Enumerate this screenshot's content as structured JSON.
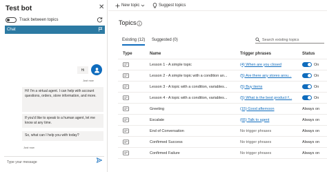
{
  "bot_panel": {
    "title": "Test bot",
    "close_glyph": "✕",
    "track_label": "Track between topics",
    "chat_header": "Chat",
    "user_message": "Hi",
    "user_time": "Just now",
    "bot_messages": [
      "Hi! I'm a virtual agent. I can help with account questions, orders, store information, and more.",
      "If you'd like to speak to a human agent, let me know at any time.",
      "So, what can I help you with today?"
    ],
    "bot_time": "Just now",
    "input_placeholder": "Type your message",
    "icons": [
      "refresh-icon",
      "flag-icon",
      "user-avatar-icon",
      "send-icon"
    ]
  },
  "toolbar": {
    "new_topic": "New topic",
    "suggest_topics": "Suggest topics"
  },
  "topics": {
    "title": "Topics",
    "tabs": [
      "Existing (12)",
      "Suggested (0)"
    ],
    "search_placeholder": "Search existing topics",
    "columns": [
      "Type",
      "Name",
      "Trigger phrases",
      "Status"
    ],
    "rows": [
      {
        "name": "Lesson 1 - A simple topic",
        "trigger": "(4) When are you closed",
        "status": "On",
        "toggle": true
      },
      {
        "name": "Lesson 2 - A simple topic with a condition an...",
        "trigger": "(5) Are there any stores arou...",
        "status": "On",
        "toggle": true
      },
      {
        "name": "Lesson 3 - A topic with a condition, variables...",
        "trigger": "(5) Buy items",
        "status": "On",
        "toggle": true
      },
      {
        "name": "Lesson 4 - A topic with a condition, variables...",
        "trigger": "(5) What is the best product f...",
        "status": "On",
        "toggle": true
      },
      {
        "name": "Greeting",
        "trigger": "(15) Good afternoon",
        "status": "Always on",
        "toggle": false
      },
      {
        "name": "Escalate",
        "trigger": "(65) Talk to agent",
        "status": "Always on",
        "toggle": false
      },
      {
        "name": "End of Conversation",
        "trigger": "No trigger phrases",
        "status": "Always on",
        "toggle": false
      },
      {
        "name": "Confirmed Success",
        "trigger": "No trigger phrases",
        "status": "Always on",
        "toggle": false
      },
      {
        "name": "Confirmed Failure",
        "trigger": "No trigger phrases",
        "status": "Always on",
        "toggle": false
      }
    ]
  },
  "colors": {
    "accent": "#0f6cbd",
    "chat_header": "#2c7aa3",
    "bubble": "#f3f2f1"
  }
}
